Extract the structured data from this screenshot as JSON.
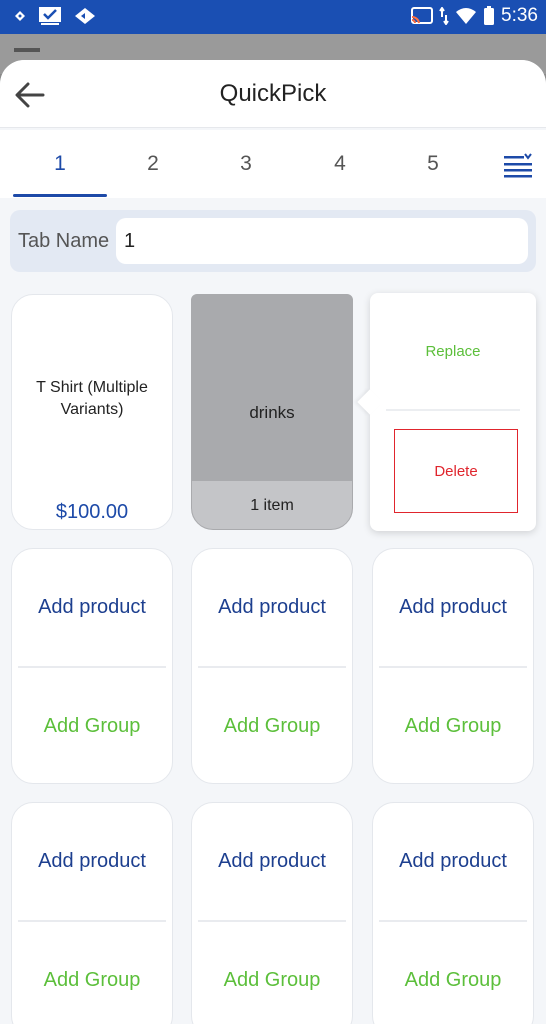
{
  "status_bar": {
    "time": "5:36",
    "bg_color": "#1a4fb3",
    "left_icons": [
      "notification-dot-icon",
      "checkbox-mail-icon",
      "diamond-arrows-icon"
    ],
    "right_icons": [
      "cast-icon",
      "data-arrows-icon",
      "wifi-icon",
      "battery-icon"
    ]
  },
  "header": {
    "title": "QuickPick",
    "back_icon": "arrow-left-icon"
  },
  "tabs": {
    "items": [
      {
        "label": "1",
        "active": true
      },
      {
        "label": "2",
        "active": false
      },
      {
        "label": "3",
        "active": false
      },
      {
        "label": "4",
        "active": false
      },
      {
        "label": "5",
        "active": false
      }
    ],
    "menu_icon": "sort-list-icon",
    "active_color": "#1d4aa8"
  },
  "tab_name": {
    "label": "Tab Name",
    "value": "1"
  },
  "grid": {
    "product_tile": {
      "name": "T Shirt (Multiple Variants)",
      "price": "$100.00"
    },
    "group_tile": {
      "name": "drinks",
      "count": "1 item"
    },
    "popover": {
      "replace_label": "Replace",
      "delete_label": "Delete"
    },
    "empty_tiles": [
      {
        "add_product": "Add product",
        "add_group": "Add Group"
      },
      {
        "add_product": "Add product",
        "add_group": "Add Group"
      },
      {
        "add_product": "Add product",
        "add_group": "Add Group"
      },
      {
        "add_product": "Add product",
        "add_group": "Add Group"
      },
      {
        "add_product": "Add product",
        "add_group": "Add Group"
      },
      {
        "add_product": "Add product",
        "add_group": "Add Group"
      }
    ]
  },
  "colors": {
    "primary_blue": "#1d4aa8",
    "product_link": "#1d3f8f",
    "group_green": "#5cbf3b",
    "delete_red": "#e0252d"
  }
}
